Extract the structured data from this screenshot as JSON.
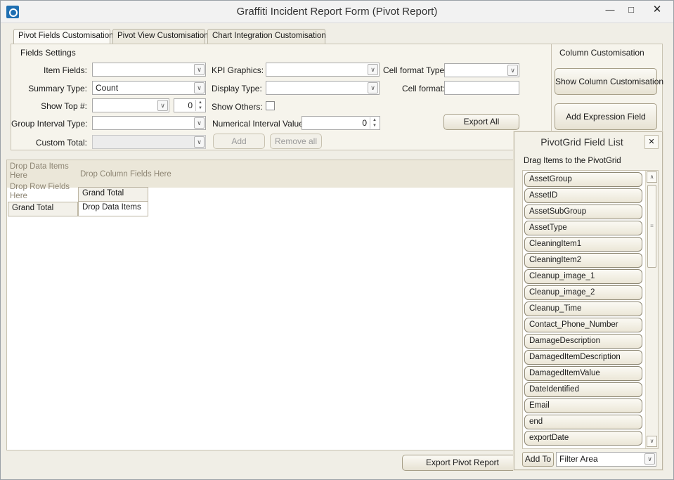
{
  "window": {
    "title": "Graffiti Incident Report Form (Pivot Report)"
  },
  "tabs": [
    {
      "label": "Pivot Fields Customisation",
      "active": true
    },
    {
      "label": "Pivot View Customisation",
      "active": false
    },
    {
      "label": "Chart Integration Customisation",
      "active": false
    }
  ],
  "fields_settings": {
    "title": "Fields Settings",
    "item_fields": {
      "label": "Item Fields:",
      "value": ""
    },
    "summary_type": {
      "label": "Summary Type:",
      "value": "Count"
    },
    "show_top": {
      "label": "Show Top #:",
      "value": "",
      "count": "0"
    },
    "group_interval_type": {
      "label": "Group Interval Type:",
      "value": ""
    },
    "custom_total": {
      "label": "Custom Total:",
      "value": ""
    },
    "kpi_graphics": {
      "label": "KPI Graphics:",
      "value": ""
    },
    "display_type": {
      "label": "Display Type:",
      "value": ""
    },
    "show_others": {
      "label": "Show Others:"
    },
    "numerical_interval": {
      "label": "Numerical Interval Value:",
      "value": "0"
    },
    "cell_format_type": {
      "label": "Cell format Type:",
      "value": ""
    },
    "cell_format": {
      "label": "Cell format:",
      "value": ""
    },
    "add_label": "Add",
    "remove_all_label": "Remove all",
    "export_all_label": "Export All"
  },
  "column_customisation": {
    "title": "Column Customisation",
    "show_button": "Show Column Customisation",
    "add_expression_button": "Add Expression Field"
  },
  "pivot_grid": {
    "drop_data_items": "Drop Data Items Here",
    "drop_column_fields": "Drop Column Fields Here",
    "drop_row_fields": "Drop Row Fields Here",
    "column_grand_total": "Grand Total",
    "row_grand_total": "Grand Total",
    "drop_data_cell": "Drop Data Items"
  },
  "export_pivot_label": "Export Pivot Report",
  "field_list": {
    "title": "PivotGrid Field List",
    "subtitle": "Drag Items to the PivotGrid",
    "items": [
      "AssetGroup",
      "AssetID",
      "AssetSubGroup",
      "AssetType",
      "CleaningItem1",
      "CleaningItem2",
      "Cleanup_image_1",
      "Cleanup_image_2",
      "Cleanup_Time",
      "Contact_Phone_Number",
      "DamageDescription",
      "DamagedItemDescription",
      "DamagedItemValue",
      "DateIdentified",
      "Email",
      "end",
      "exportDate"
    ],
    "add_to_label": "Add To",
    "area_value": "Filter Area"
  },
  "icons": {
    "app": "app-logo-icon",
    "minimize": "minimize-icon",
    "maximize": "maximize-icon",
    "close": "close-icon",
    "dropdown": "chevron-down-icon"
  }
}
